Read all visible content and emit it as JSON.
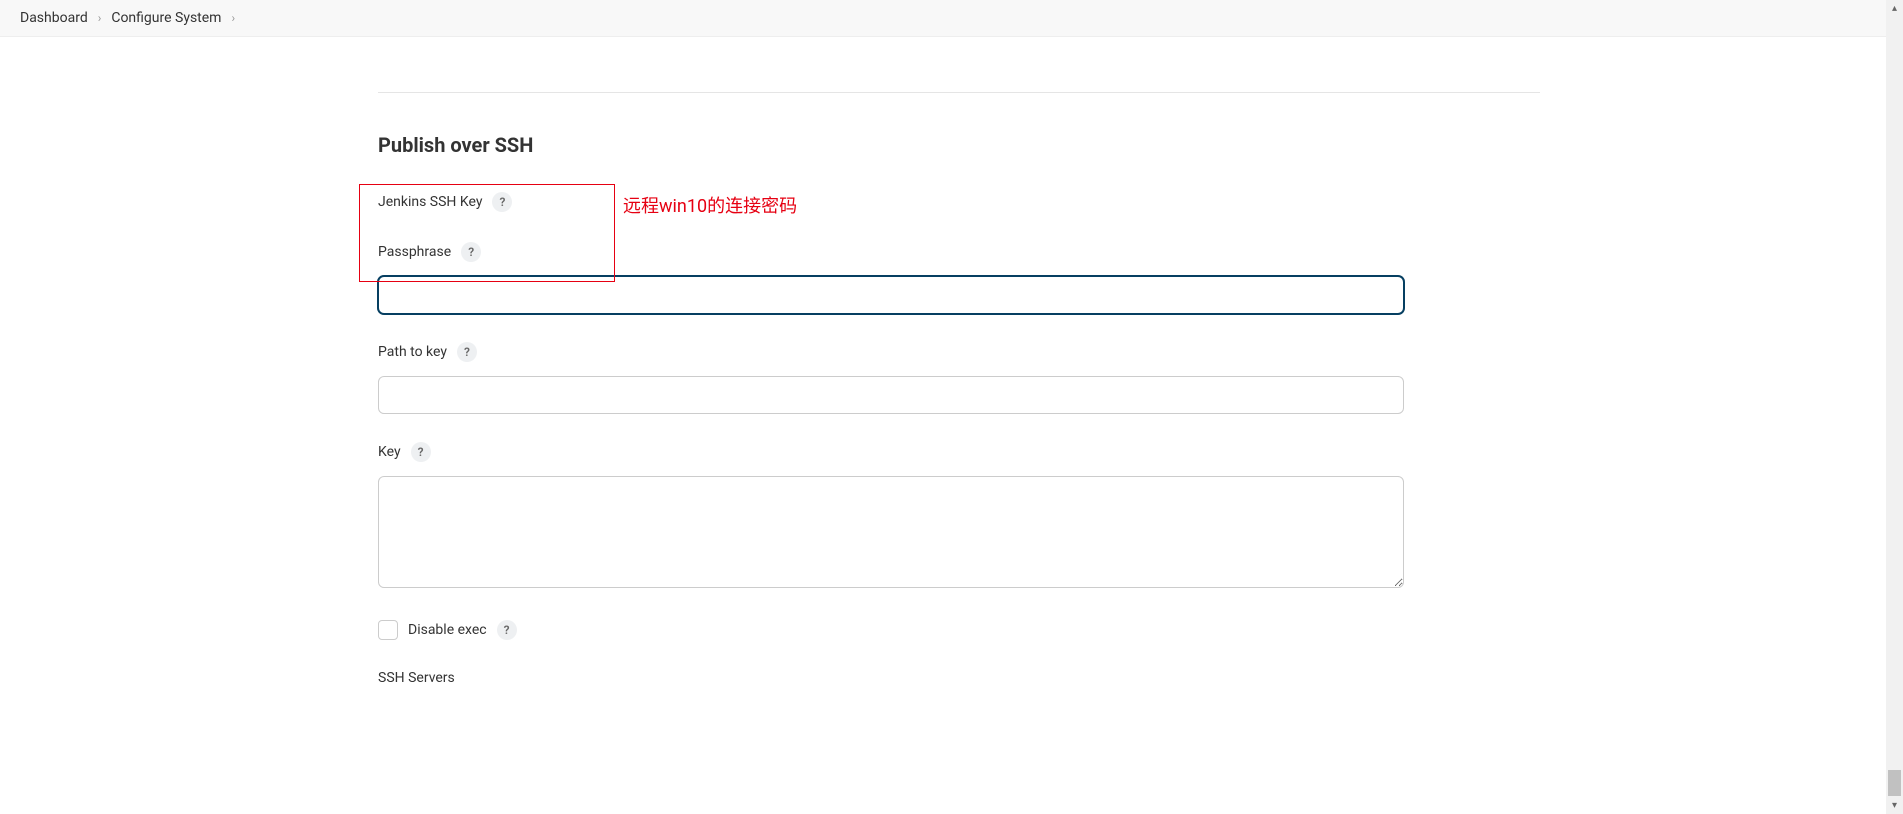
{
  "breadcrumb": {
    "items": [
      {
        "label": "Dashboard"
      },
      {
        "label": "Configure System"
      }
    ]
  },
  "section": {
    "title": "Publish over SSH",
    "subsection": "Jenkins SSH Key"
  },
  "fields": {
    "passphrase": {
      "label": "Passphrase",
      "value": ""
    },
    "pathToKey": {
      "label": "Path to key",
      "value": ""
    },
    "key": {
      "label": "Key",
      "value": ""
    },
    "disableExec": {
      "label": "Disable exec",
      "checked": false
    },
    "sshServers": {
      "label": "SSH Servers"
    }
  },
  "annotation": {
    "passphraseNote": "远程win10的连接密码"
  },
  "helpIcon": "?"
}
